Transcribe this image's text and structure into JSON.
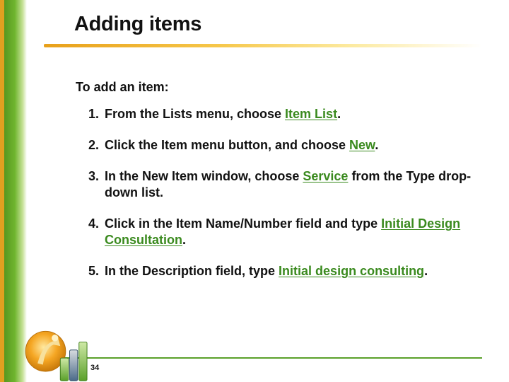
{
  "title": "Adding items",
  "intro": "To add an item:",
  "steps": [
    {
      "n": "1.",
      "pre": "From the Lists menu, choose ",
      "hl": "Item List",
      "post": "."
    },
    {
      "n": "2.",
      "pre": "Click the Item menu button, and choose ",
      "hl": "New",
      "post": "."
    },
    {
      "n": "3.",
      "pre": "In the New Item window, choose ",
      "hl": "Service",
      "post": " from the Type drop-down list."
    },
    {
      "n": "4.",
      "pre": "Click in the Item Name/Number field and type ",
      "hl": "Initial Design Consultation",
      "post": "."
    },
    {
      "n": "5.",
      "pre": "In the Description field, type ",
      "hl": "Initial design consulting",
      "post": "."
    }
  ],
  "page_number": "34",
  "colors": {
    "accent_green": "#3a8a1e",
    "sidebar_green": "#6fb52e",
    "rule_gold": "#e8a01a"
  }
}
